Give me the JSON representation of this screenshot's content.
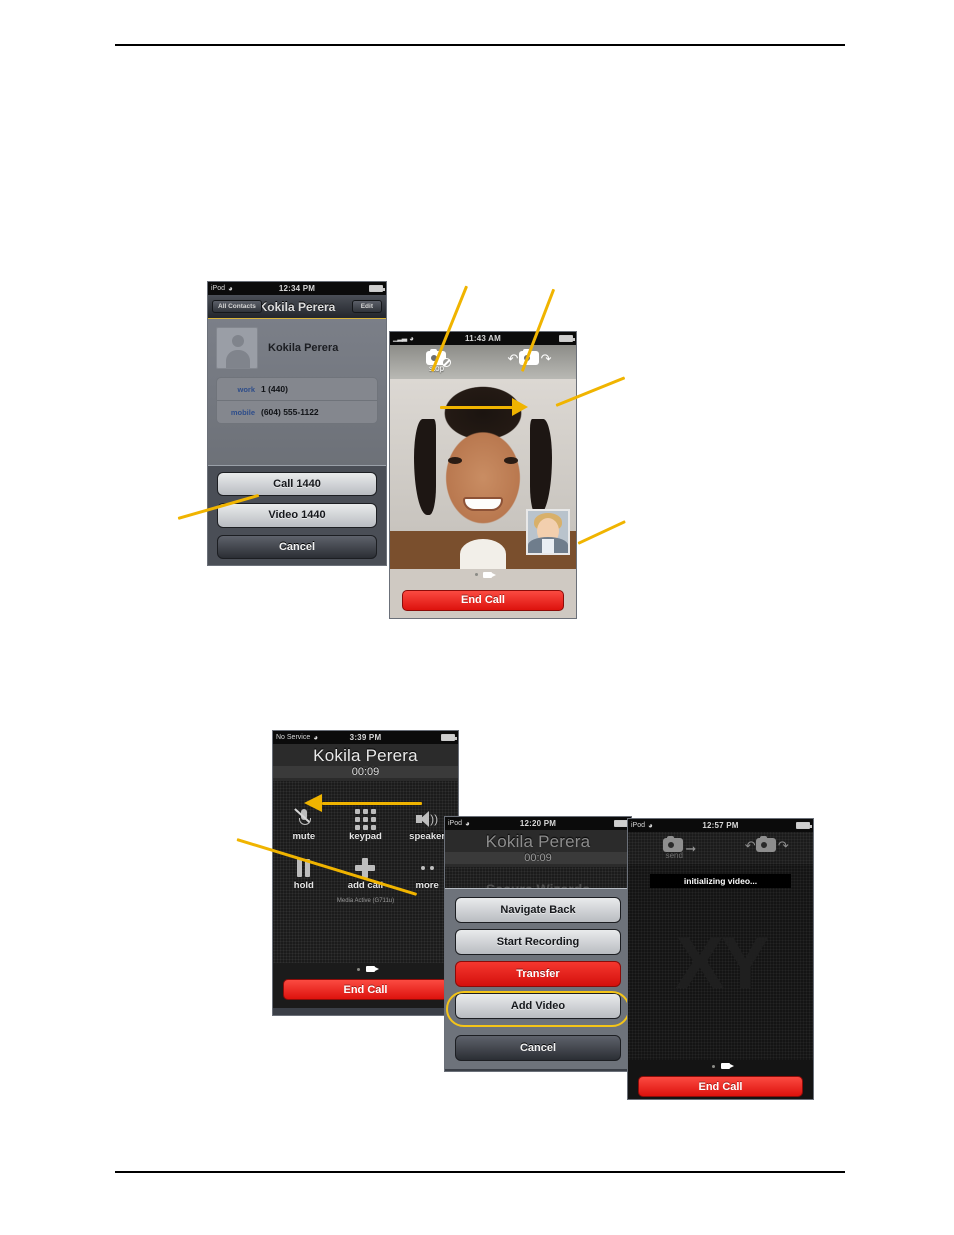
{
  "document": {
    "rules": [
      "top-rule",
      "bottom-rule"
    ]
  },
  "phone_contact": {
    "status": {
      "carrier": "iPod",
      "wifi": "wifi-icon",
      "time": "12:34 PM",
      "battery": "battery-icon"
    },
    "nav": {
      "back": "All Contacts",
      "title": "Kokila Perera",
      "edit": "Edit"
    },
    "contact_name": "Kokila Perera",
    "fields": [
      {
        "label": "work",
        "value": "1 (440)"
      },
      {
        "label": "mobile",
        "value": "(604) 555-1122"
      }
    ],
    "actions": [
      {
        "label": "Call 1440",
        "style": "light"
      },
      {
        "label": "Video 1440",
        "style": "light"
      },
      {
        "label": "Cancel",
        "style": "dark"
      }
    ]
  },
  "phone_video": {
    "status": {
      "carrier": "signal-icon",
      "wifi": "wifi-icon",
      "time": "11:43 AM",
      "battery": "battery-icon"
    },
    "tools": [
      {
        "name": "stop-video",
        "label": "stop",
        "icon": "camera-stop-icon"
      },
      {
        "name": "swap-camera",
        "label": "",
        "icon": "camera-rotate-icon"
      }
    ],
    "far_end_video": "far-end-video-image",
    "near_end_pip": "near-end-video-pip",
    "page_dots": [
      "dot",
      "video-icon"
    ],
    "end_call": "End Call"
  },
  "phone_incall": {
    "status": {
      "carrier": "No Service",
      "wifi": "wifi-icon",
      "time": "3:39 PM",
      "battery": "battery-icon"
    },
    "caller": "Kokila Perera",
    "duration": "00:09",
    "keys": [
      {
        "label": "mute",
        "icon": "mic-muted-icon"
      },
      {
        "label": "keypad",
        "icon": "keypad-icon"
      },
      {
        "label": "speaker",
        "icon": "speaker-icon"
      },
      {
        "label": "hold",
        "icon": "pause-icon"
      },
      {
        "label": "add call",
        "icon": "plus-icon"
      },
      {
        "label": "more",
        "icon": "more-dots-icon"
      }
    ],
    "media_status": "Media Active (G711u)",
    "page_dots": [
      "dot",
      "video-icon"
    ],
    "end_call": "End Call"
  },
  "phone_sheet": {
    "status": {
      "carrier": "iPod",
      "wifi": "wifi-icon",
      "time": "12:20 PM",
      "battery": "battery-icon"
    },
    "caller": "Kokila Perera",
    "duration": "00:09",
    "ghost_label": "Secure Wizards",
    "actions": [
      {
        "label": "Navigate Back",
        "style": "light"
      },
      {
        "label": "Start Recording",
        "style": "light"
      },
      {
        "label": "Transfer",
        "style": "red"
      },
      {
        "label": "Add Video",
        "style": "light",
        "highlighted": true
      },
      {
        "label": "Cancel",
        "style": "dark"
      }
    ]
  },
  "phone_init": {
    "status": {
      "carrier": "iPod",
      "wifi": "wifi-icon",
      "time": "12:57 PM",
      "battery": "battery-icon"
    },
    "tools": [
      {
        "name": "send-video",
        "label": "send",
        "icon": "camera-send-icon"
      },
      {
        "name": "swap-camera",
        "label": "",
        "icon": "camera-rotate-icon"
      }
    ],
    "banner": "initializing video...",
    "watermark": "XY",
    "page_dots": [
      "dot",
      "video-icon"
    ],
    "end_call": "End Call"
  },
  "colors": {
    "callout": "#f0b400",
    "highlight": "#f5c518",
    "end_call_red": "#e5140f",
    "transfer_red": "#ee2a22"
  }
}
